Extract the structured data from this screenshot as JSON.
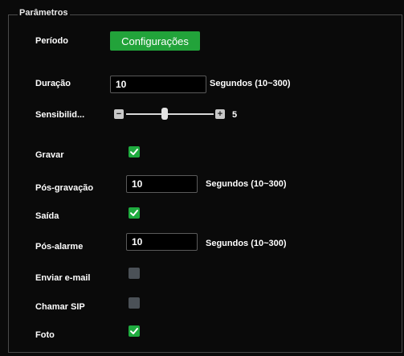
{
  "section": {
    "legend": "Parâmetros"
  },
  "periodo": {
    "label": "Período",
    "button_label": "Configurações"
  },
  "duracao": {
    "label": "Duração",
    "value": "10",
    "unit": "Segundos (10~300)"
  },
  "sensibilidade": {
    "label": "Sensibilid...",
    "value": "5",
    "level_fraction": 0.44
  },
  "gravar": {
    "label": "Gravar",
    "checked": true
  },
  "pos_gravacao": {
    "label": "Pós-gravação",
    "value": "10",
    "unit": "Segundos (10~300)"
  },
  "saida": {
    "label": "Saída",
    "checked": true
  },
  "pos_alarme": {
    "label": "Pós-alarme",
    "value": "10",
    "unit": "Segundos (10~300)"
  },
  "enviar_email": {
    "label": "Enviar e-mail",
    "checked": false
  },
  "chamar_sip": {
    "label": "Chamar SIP",
    "checked": false
  },
  "foto": {
    "label": "Foto",
    "checked": true
  },
  "colors": {
    "accent_green": "#22a33a",
    "checkbox_on": "#1fab3f",
    "checkbox_off": "#4b5157",
    "background": "#0a0a0a"
  }
}
